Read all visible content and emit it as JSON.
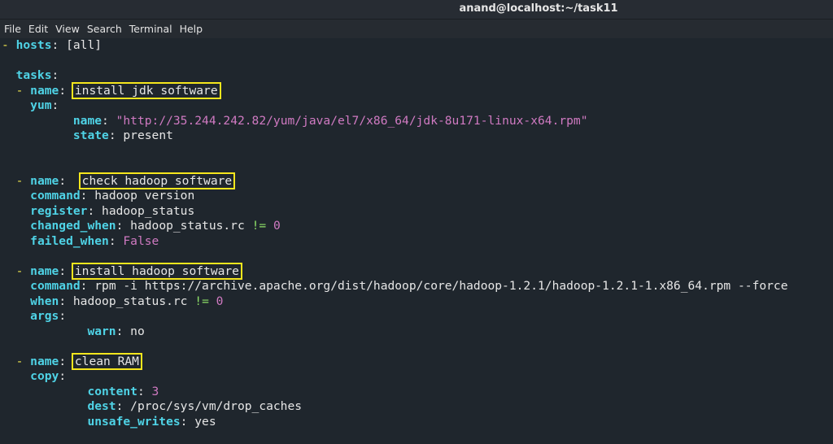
{
  "window": {
    "title": "anand@localhost:~/task11"
  },
  "menu": {
    "items": [
      "File",
      "Edit",
      "View",
      "Search",
      "Terminal",
      "Help"
    ]
  },
  "code": {
    "hosts_key": "hosts",
    "hosts_value": "[all]",
    "tasks_key": "tasks",
    "task1": {
      "name_key": "name",
      "name_value": "install jdk software",
      "module_key": "yum",
      "name2_key": "name",
      "url": "\"http://35.244.242.82/yum/java/el7/x86_64/jdk-8u171-linux-x64.rpm\"",
      "state_key": "state",
      "state_value": "present"
    },
    "task2": {
      "name_key": "name",
      "name_value": "check hadoop software",
      "command_key": "command",
      "command_value": "hadoop version",
      "register_key": "register",
      "register_value": "hadoop_status",
      "changed_key": "changed_when",
      "changed_value": "hadoop_status.rc",
      "changed_op": "!=",
      "changed_num": "0",
      "failed_key": "failed_when",
      "failed_value": "False"
    },
    "task3": {
      "name_key": "name",
      "name_value": "install hadoop software",
      "command_key": "command",
      "command_value": "rpm -i https://archive.apache.org/dist/hadoop/core/hadoop-1.2.1/hadoop-1.2.1-1.x86_64.rpm --force",
      "when_key": "when",
      "when_value": "hadoop_status.rc",
      "when_op": "!=",
      "when_num": "0",
      "args_key": "args",
      "warn_key": "warn",
      "warn_value": "no"
    },
    "task4": {
      "name_key": "name",
      "name_value": "clean RAM",
      "module_key": "copy",
      "content_key": "content",
      "content_value": "3",
      "dest_key": "dest",
      "dest_value": "/proc/sys/vm/drop_caches",
      "unsafe_key": "unsafe_writes",
      "unsafe_value": "yes"
    }
  },
  "colors": {
    "background": "#1f262d",
    "key": "#4fd3e6",
    "dash": "#f0e64e",
    "string": "#d07ac2",
    "operator": "#8ee068",
    "highlight_box": "#f5e61d"
  }
}
